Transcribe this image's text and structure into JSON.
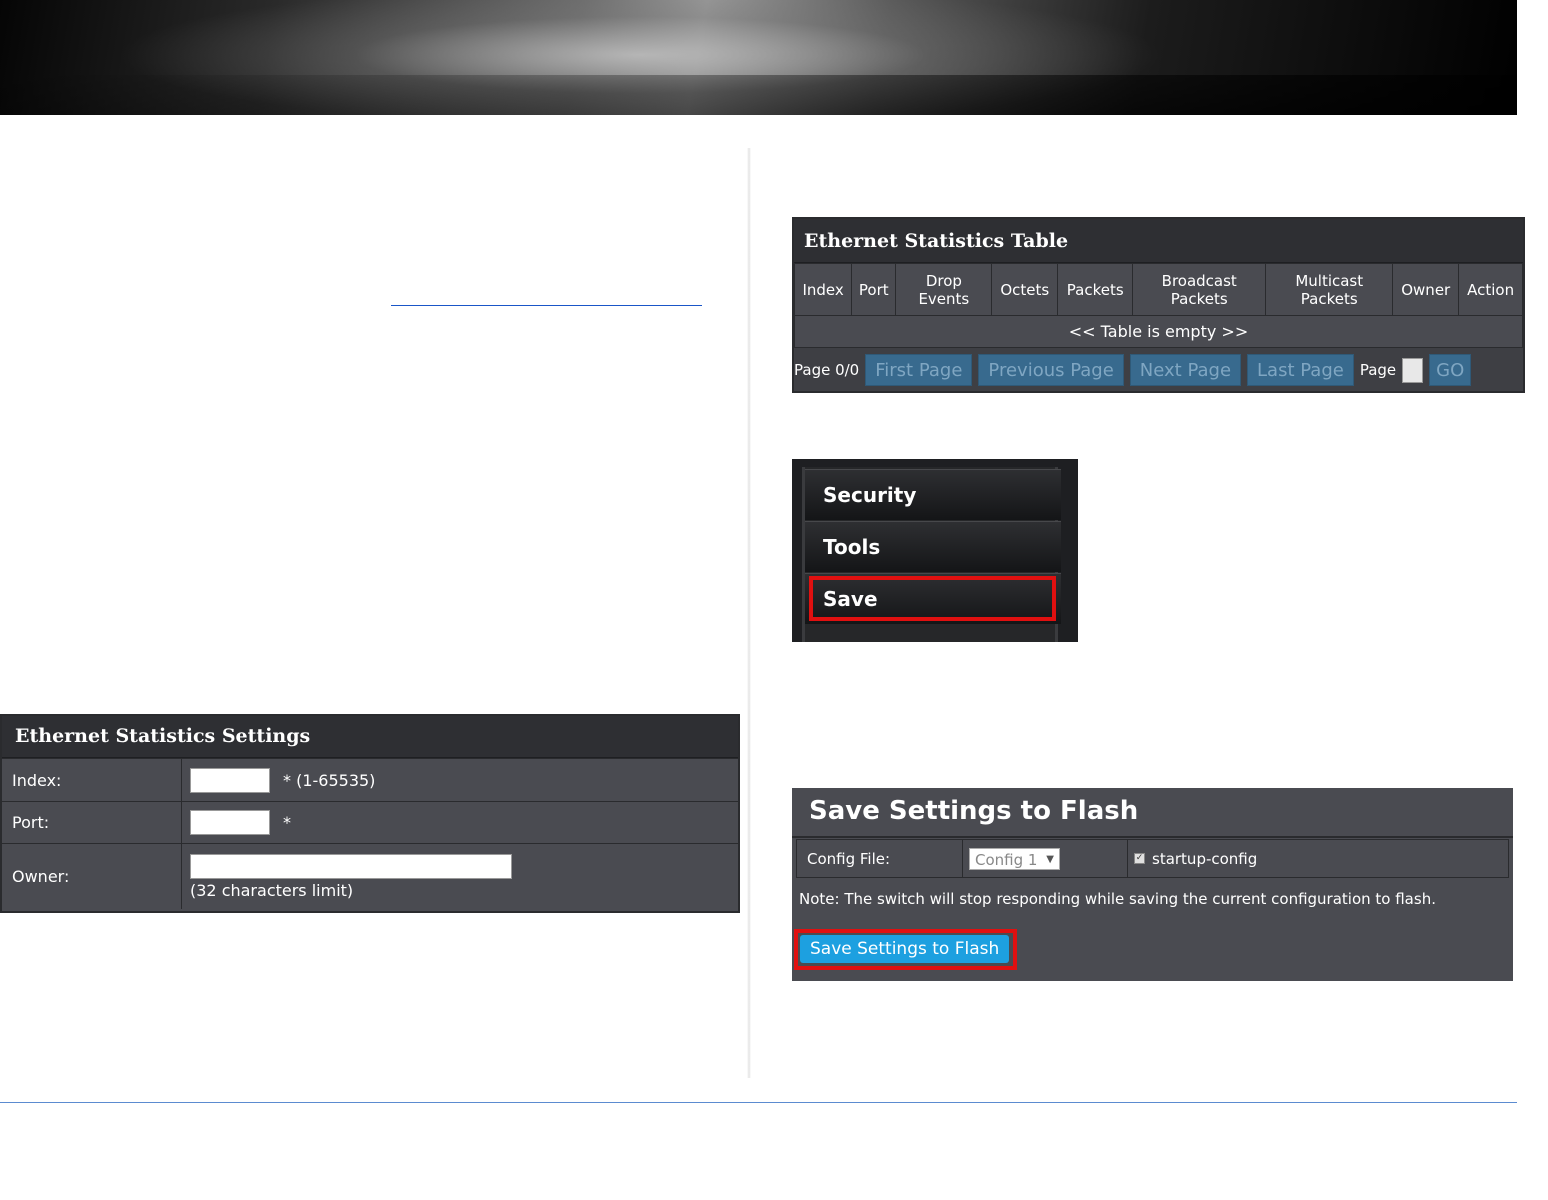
{
  "settings_panel": {
    "title": "Ethernet Statistics Settings",
    "index_label": "Index:",
    "index_hint": "* (1-65535)",
    "port_label": "Port:",
    "port_hint": "*",
    "owner_label": "Owner:",
    "owner_hint": "(32 characters limit)"
  },
  "stats_table": {
    "title": "Ethernet Statistics Table",
    "columns": [
      "Index",
      "Port",
      "Drop Events",
      "Octets",
      "Packets",
      "Broadcast Packets",
      "Multicast Packets",
      "Owner",
      "Action"
    ],
    "empty_message": "<< Table is empty >>",
    "pager": {
      "page_status": "Page 0/0",
      "first": "First Page",
      "previous": "Previous Page",
      "next": "Next Page",
      "last": "Last Page",
      "page_label": "Page",
      "go": "GO"
    }
  },
  "menu": {
    "items": [
      "Security",
      "Tools",
      "Save"
    ],
    "highlighted": "Save"
  },
  "save_panel": {
    "title": "Save Settings to Flash",
    "config_file_label": "Config File:",
    "config_selected": "Config 1",
    "startup_label": "startup-config",
    "note": "Note: The switch will stop responding while saving the current configuration to flash.",
    "button": "Save Settings to Flash"
  },
  "colors": {
    "panel_bg": "#4a4b51",
    "title_bg": "#2e2f33",
    "button_blue": "#1da0e0",
    "highlight_red": "#e01010",
    "link_blue": "#1a56c8"
  }
}
